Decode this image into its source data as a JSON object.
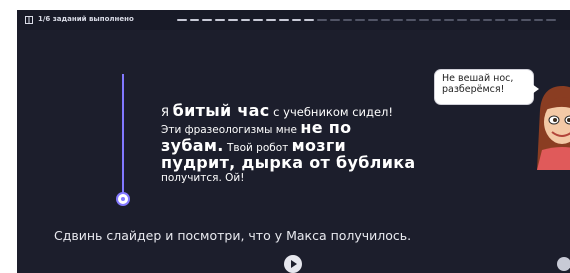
{
  "progress": {
    "label": "1/6 заданий выполнено",
    "completed": 1,
    "total": 6,
    "segments_done": 11,
    "segments_total": 30
  },
  "story": {
    "w1": "Я ",
    "w2": "битый час",
    "w3": " с учебником сидел!",
    "w4": "Эти фразеологизмы мне ",
    "w5": "не по",
    "w6": "зубам.",
    "w7": " Твой робот ",
    "w8": "мозги",
    "w9": "пудрит, дырка от бублика",
    "w10": "получится. Ой!"
  },
  "bubble": {
    "text": "Не вешай нос, разберёмся!"
  },
  "instruction": "Сдвинь слайдер и посмотри, что у Макса получилось.",
  "slider": {
    "value": 1
  },
  "colors": {
    "background": "#1c1e2c",
    "accent": "#8278ff",
    "text": "#ffffff"
  },
  "icons": {
    "progress": "book-icon",
    "play": "play-icon",
    "corner": "settings-icon"
  }
}
